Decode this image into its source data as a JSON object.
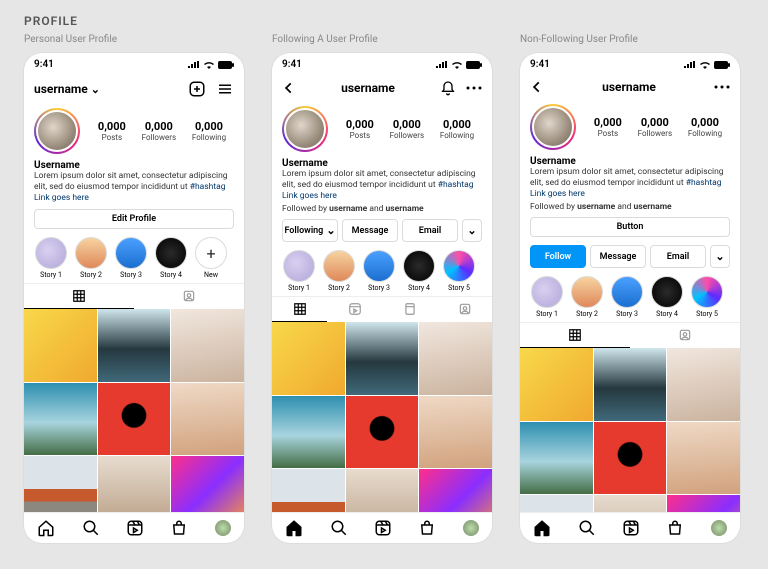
{
  "page": {
    "title": "PROFILE"
  },
  "captions": [
    "Personal User Profile",
    "Following A User Profile",
    "Non-Following User Profile"
  ],
  "status": {
    "time": "9:41"
  },
  "profile": {
    "username": "username",
    "display_name": "Username",
    "bio_pre": "Lorem ipsum dolor sit amet, consectetur adipiscing elit, sed do eiusmod tempor incididunt ut ",
    "hashtag": "#hashtag",
    "link": "Link goes here",
    "followed_pre": "Followed by ",
    "followed_a": "username",
    "followed_mid": " and ",
    "followed_b": "username"
  },
  "stats": {
    "posts_n": "0,000",
    "posts_l": "Posts",
    "followers_n": "0,000",
    "followers_l": "Followers",
    "following_n": "0,000",
    "following_l": "Following"
  },
  "buttons": {
    "edit": "Edit Profile",
    "following": "Following",
    "message": "Message",
    "email": "Email",
    "button": "Button",
    "follow": "Follow"
  },
  "stories": {
    "s1": "Story 1",
    "s2": "Story 2",
    "s3": "Story 3",
    "s4": "Story 4",
    "s5": "Story 5",
    "new": "New"
  }
}
